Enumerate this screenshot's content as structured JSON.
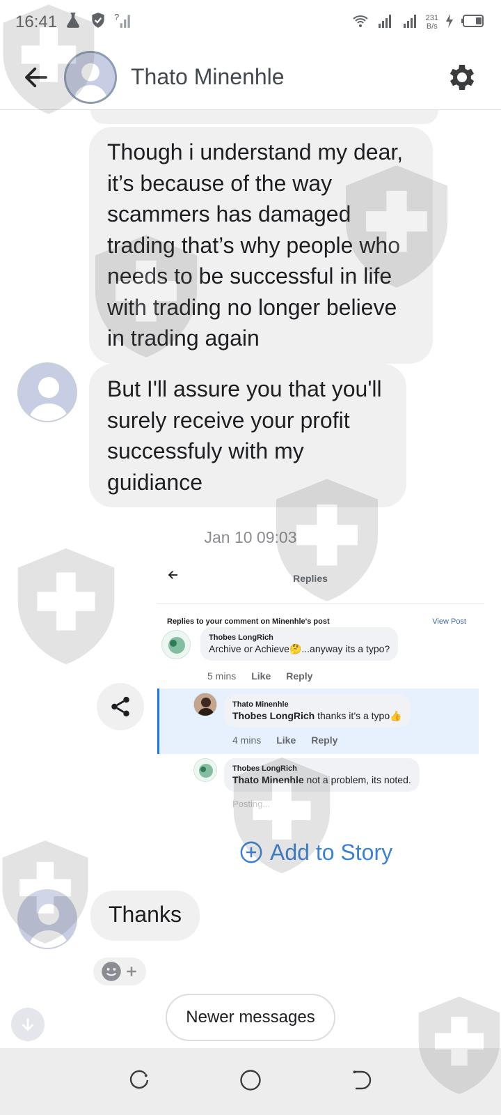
{
  "status_bar": {
    "time": "16:41",
    "network_speed_value": "231",
    "network_speed_unit": "B/s"
  },
  "header": {
    "contact_name": "Thato Minenhle",
    "back_icon": "arrow-left-icon",
    "settings_icon": "gear-icon"
  },
  "messages": [
    {
      "text": "Though i understand my dear, it’s because of the way scammers has damaged trading that’s why people who needs to be successful in life with trading no longer believe in trading again"
    },
    {
      "text": "But I'll assure you that you'll surely receive your profit successfuly with my guidiance"
    }
  ],
  "timestamp": "Jan 10 09:03",
  "shared_screenshot": {
    "title": "Replies",
    "subtitle": "Replies to your comment on Minenhle's post",
    "view_post": "View Post",
    "comments": [
      {
        "name": "Thobes LongRich",
        "text": "Archive or Achieve🤔...anyway its a typo?",
        "time": "5 mins",
        "like": "Like",
        "reply": "Reply"
      },
      {
        "name": "Thato Minenhle",
        "mention": "Thobes LongRich",
        "text": " thanks it’s a typo👍",
        "time": "4 mins",
        "like": "Like",
        "reply": "Reply"
      },
      {
        "name": "Thobes LongRich",
        "mention": "Thato Minenhle",
        "text": " not a problem, its noted."
      }
    ],
    "posting": "Posting..."
  },
  "add_to_story": "Add to Story",
  "last_message": "Thanks",
  "newer_messages": "Newer messages",
  "accent_color": "#3b82d6"
}
